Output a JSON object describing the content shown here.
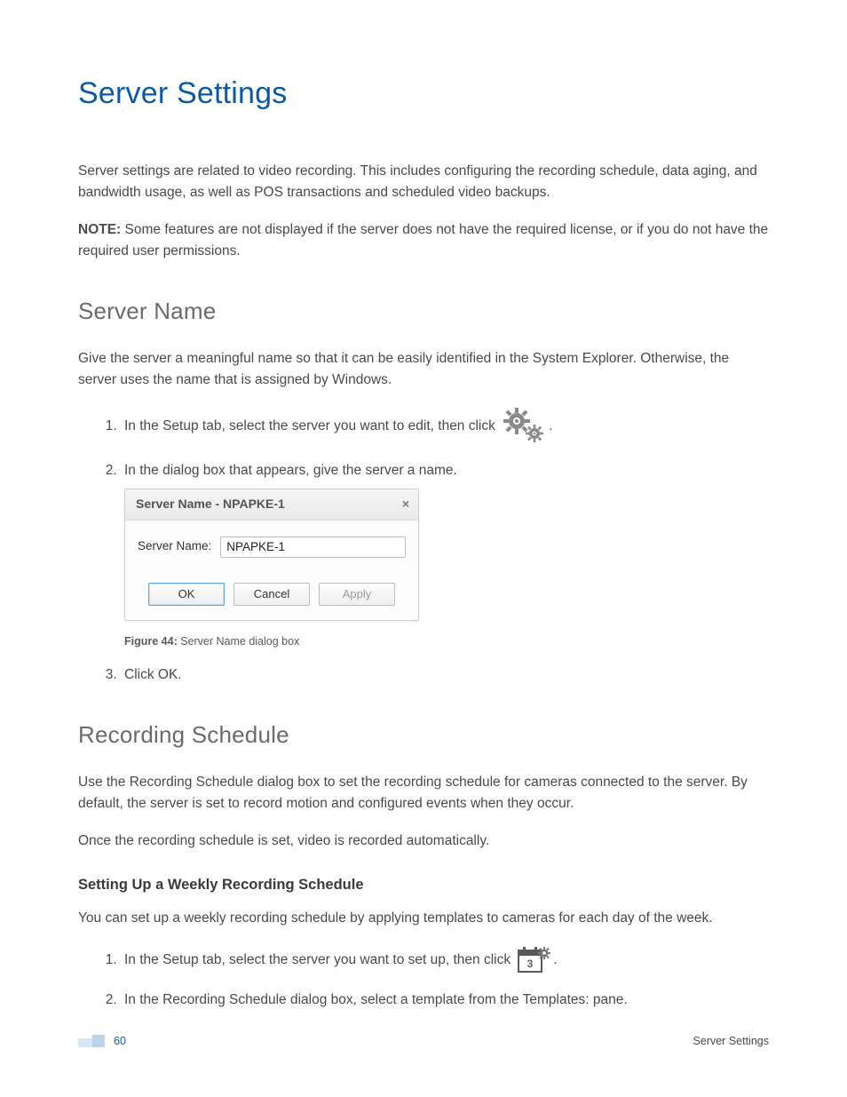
{
  "page": {
    "title": "Server Settings",
    "intro1": "Server settings are related to video recording. This includes configuring the recording schedule, data aging, and bandwidth usage, as well as POS transactions and scheduled video backups.",
    "note_label": "NOTE:",
    "note_body": " Some features are not displayed if the server does not have the required license, or if you do not have the required user permissions."
  },
  "server_name": {
    "heading": "Server Name",
    "intro": "Give the server a meaningful name so that it can be easily identified in the System Explorer. Otherwise, the server uses the name that is assigned by Windows.",
    "steps": {
      "s1_a": "In the Setup tab, select the server you want to edit, then click",
      "s1_b": ".",
      "s2": "In the dialog box that appears, give the server a name.",
      "s3_a": "Click ",
      "s3_b": "OK",
      "s3_c": "."
    },
    "dialog": {
      "title": "Server Name - NPAPKE-1",
      "field_label": "Server Name:",
      "field_value": "NPAPKE-1",
      "ok": "OK",
      "cancel": "Cancel",
      "apply": "Apply"
    },
    "figure_label": "Figure 44:",
    "figure_text": " Server Name dialog box"
  },
  "recording": {
    "heading": "Recording Schedule",
    "p1": "Use the Recording Schedule dialog box to set the recording schedule for cameras connected to the server. By default, the server is set to record motion and configured events when they occur.",
    "p2": "Once the recording schedule is set, video is recorded automatically.",
    "sub_heading": "Setting Up a Weekly Recording Schedule",
    "sub_p": "You can set up a weekly recording schedule by applying templates to cameras for each day of the week.",
    "steps": {
      "s1_a": "In the Setup tab, select the server you want to set up, then click",
      "s1_b": ".",
      "s2": "In the Recording Schedule dialog box, select a template from the Templates: pane."
    }
  },
  "footer": {
    "page_number": "60",
    "section": "Server Settings"
  }
}
